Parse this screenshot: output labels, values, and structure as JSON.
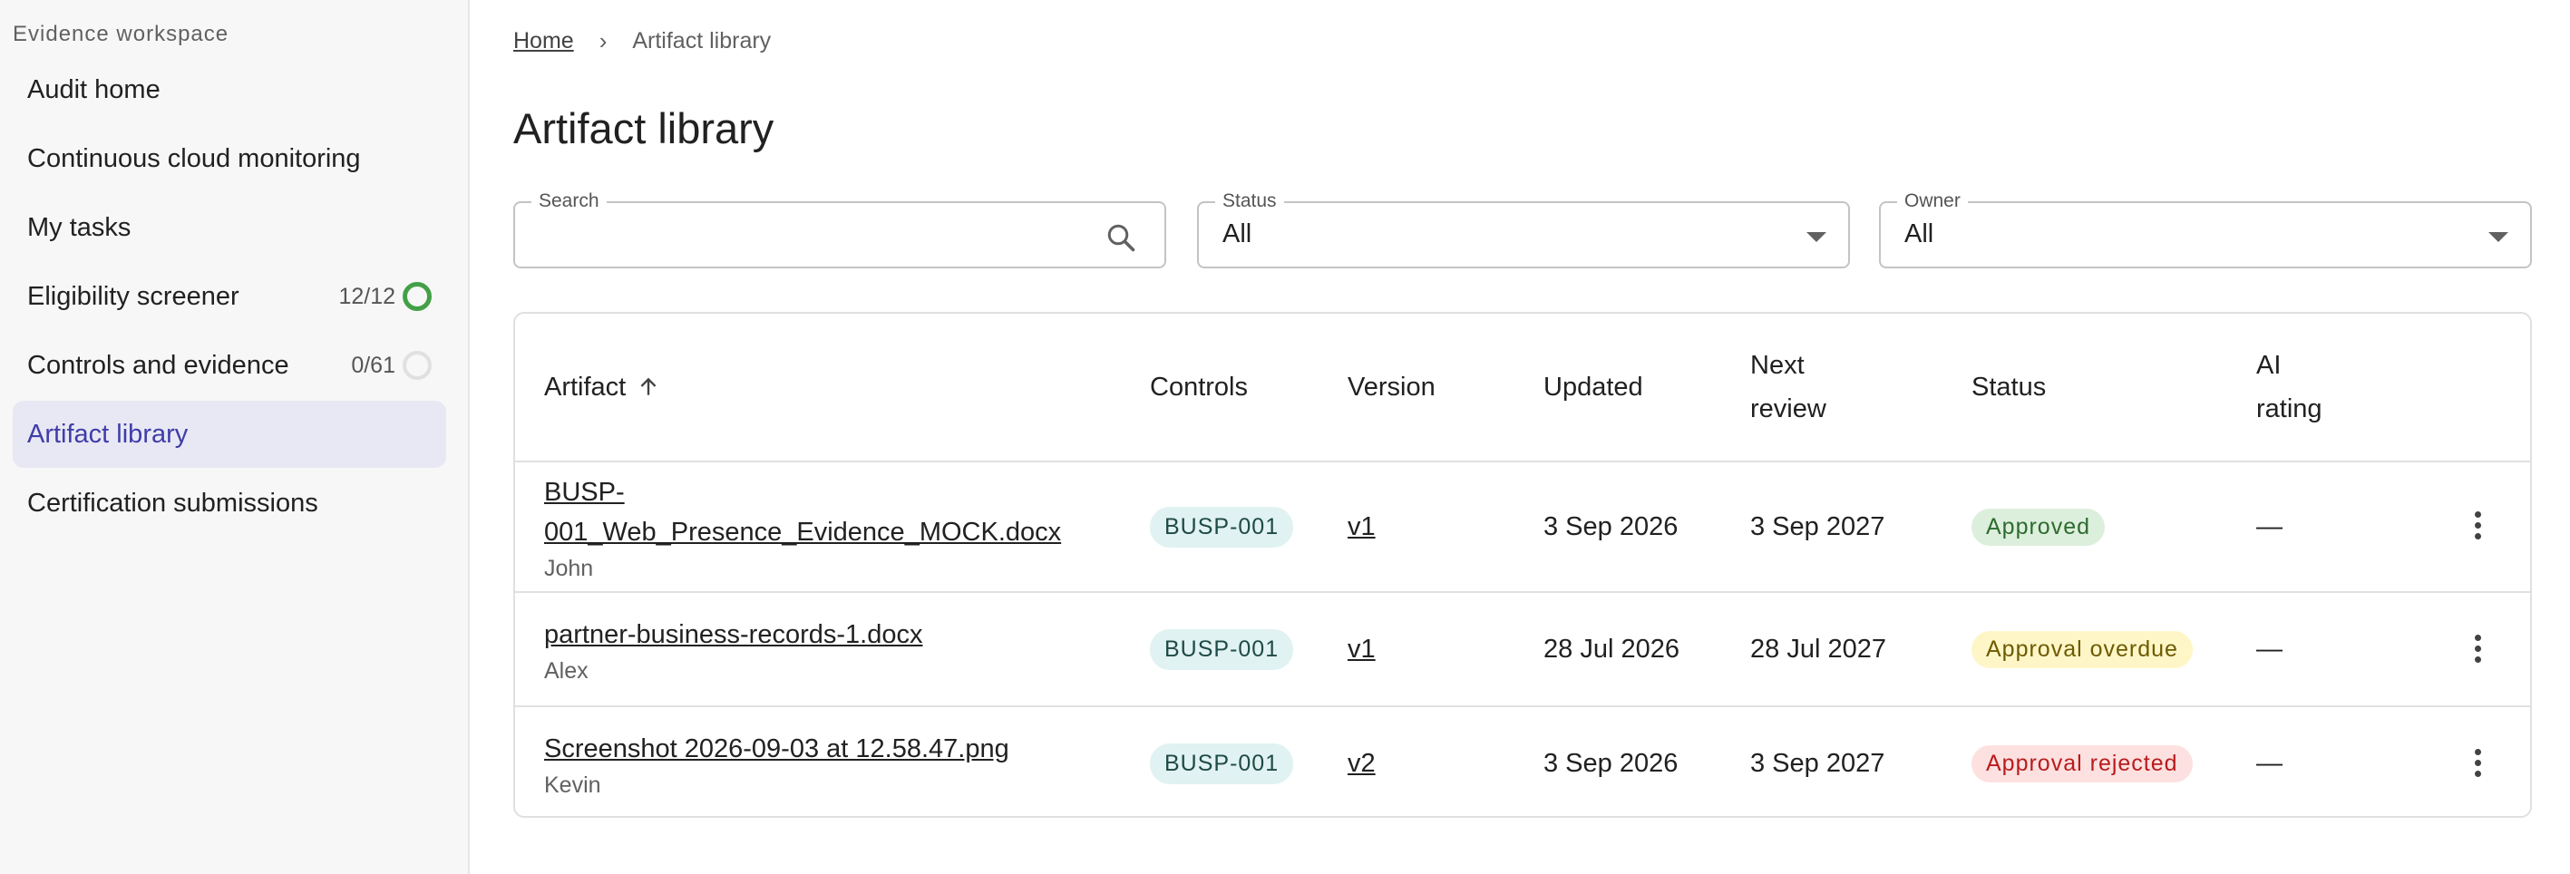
{
  "sidebar": {
    "heading": "Evidence workspace",
    "items": [
      {
        "label": "Audit home"
      },
      {
        "label": "Continuous cloud monitoring"
      },
      {
        "label": "My tasks"
      },
      {
        "label": "Eligibility screener",
        "count": "12/12",
        "status": "complete"
      },
      {
        "label": "Controls and evidence",
        "count": "0/61",
        "status": "not-started"
      },
      {
        "label": "Artifact library",
        "active": true
      },
      {
        "label": "Certification submissions"
      }
    ]
  },
  "breadcrumb": {
    "home": "Home",
    "separator": "›",
    "current": "Artifact library"
  },
  "page": {
    "title": "Artifact library"
  },
  "filters": {
    "search": {
      "label": "Search",
      "value": "",
      "icon": "search-icon"
    },
    "status": {
      "label": "Status",
      "value": "All"
    },
    "owner": {
      "label": "Owner",
      "value": "All"
    }
  },
  "table": {
    "columns": {
      "artifact": "Artifact",
      "controls": "Controls",
      "version": "Version",
      "updated": "Updated",
      "next_review_1": "Next",
      "next_review_2": "review",
      "status": "Status",
      "ai_rating_1": "AI",
      "ai_rating_2": "rating"
    },
    "sort": {
      "column": "Artifact",
      "direction": "ascending",
      "icon": "arrow-up-icon"
    },
    "rows": [
      {
        "name_1": "BUSP-",
        "name_2": "001_Web_Presence_Evidence_MOCK.docx",
        "owner": "John",
        "control": "BUSP-001",
        "version": "v1",
        "updated": "3 Sep 2026",
        "next_review": "3 Sep 2027",
        "status": "Approved",
        "ai_rating": "—"
      },
      {
        "name": "partner-business-records-1.docx",
        "owner": "Alex",
        "control": "BUSP-001",
        "version": "v1",
        "updated": "28 Jul 2026",
        "next_review": "28 Jul 2027",
        "status": "Approval overdue",
        "ai_rating": "—"
      },
      {
        "name": "Screenshot 2026-09-03 at 12.58.47.png",
        "owner": "Kevin",
        "control": "BUSP-001",
        "version": "v2",
        "updated": "3 Sep 2026",
        "next_review": "3 Sep 2027",
        "status": "Approval rejected",
        "ai_rating": "—"
      }
    ]
  },
  "colors": {
    "accent": "#3f3da8",
    "active_bg": "#e8e8f4",
    "approved": "#2e6b30",
    "overdue": "#6d5a00",
    "rejected": "#b71c1c",
    "chip_bg": "#e0f2f1"
  }
}
